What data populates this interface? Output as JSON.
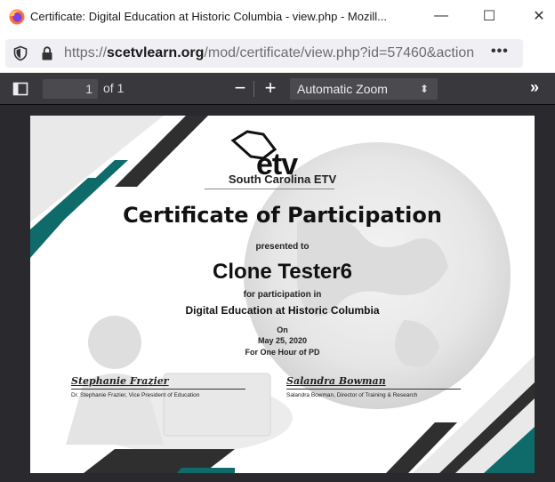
{
  "window": {
    "title": "Certificate: Digital Education at Historic Columbia - view.php - Mozill...",
    "minimize": "—",
    "maximize": "☐",
    "close": "✕"
  },
  "urlbar": {
    "prefix": "https://",
    "domain": "scetvlearn.org",
    "path": "/mod/certificate/view.php?id=57460&action",
    "more": "•••"
  },
  "pdf_toolbar": {
    "page_number": "1",
    "page_count": "of 1",
    "zoom_out": "−",
    "zoom_in": "+",
    "zoom_level": "Automatic Zoom",
    "more_tools": "»"
  },
  "certificate": {
    "logo_text": "etv",
    "logo_subtitle": "South Carolina ETV",
    "title": "Certificate of Participation",
    "presented_to": "presented to",
    "recipient": "Clone Tester6",
    "for_participation": "for participation in",
    "course": "Digital Education at Historic Columbia",
    "on_label": "On",
    "date": "May 25, 2020",
    "duration": "For One Hour of PD",
    "signatures": [
      {
        "script": "Stephanie Frazier",
        "caption": "Dr. Stephanie Frazier, Vice President of Education"
      },
      {
        "script": "Salandra Bowman",
        "caption": "Salandra Bowman, Director of Training & Research"
      }
    ]
  },
  "colors": {
    "teal": "#0f6b69",
    "dark": "#2f2f2f",
    "toolbar": "#38383d",
    "viewer_bg": "#2a2a2e"
  }
}
